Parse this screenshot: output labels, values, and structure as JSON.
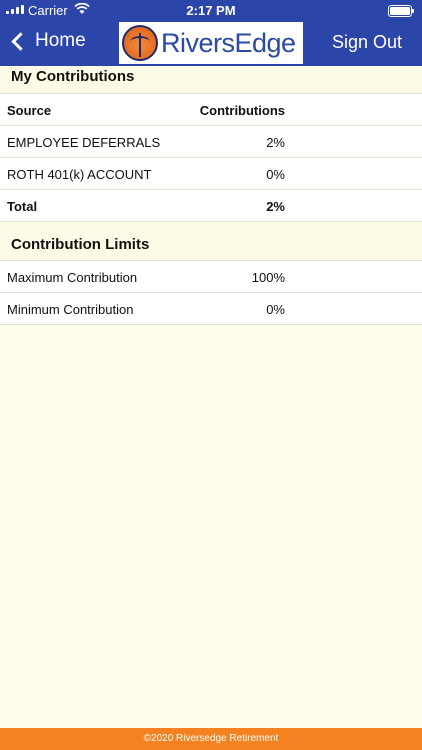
{
  "status_bar": {
    "carrier": "Carrier",
    "time": "2:17 PM"
  },
  "nav": {
    "back_label": "Home",
    "logo_text": "RiversEdge",
    "sign_out_label": "Sign Out"
  },
  "contributions": {
    "title": "My Contributions",
    "headers": {
      "source": "Source",
      "contributions": "Contributions"
    },
    "rows": [
      {
        "source": "EMPLOYEE DEFERRALS",
        "value": "2%"
      },
      {
        "source": "ROTH 401(k) ACCOUNT",
        "value": "0%"
      }
    ],
    "total": {
      "label": "Total",
      "value": "2%"
    }
  },
  "limits": {
    "title": "Contribution Limits",
    "rows": [
      {
        "label": "Maximum Contribution",
        "value": "100%"
      },
      {
        "label": "Minimum Contribution",
        "value": "0%"
      }
    ]
  },
  "footer": {
    "text": "©2020 Riversedge Retirement"
  },
  "colors": {
    "nav_blue": "#2c45a8",
    "footer_orange": "#f58220",
    "background": "#fefeea"
  }
}
